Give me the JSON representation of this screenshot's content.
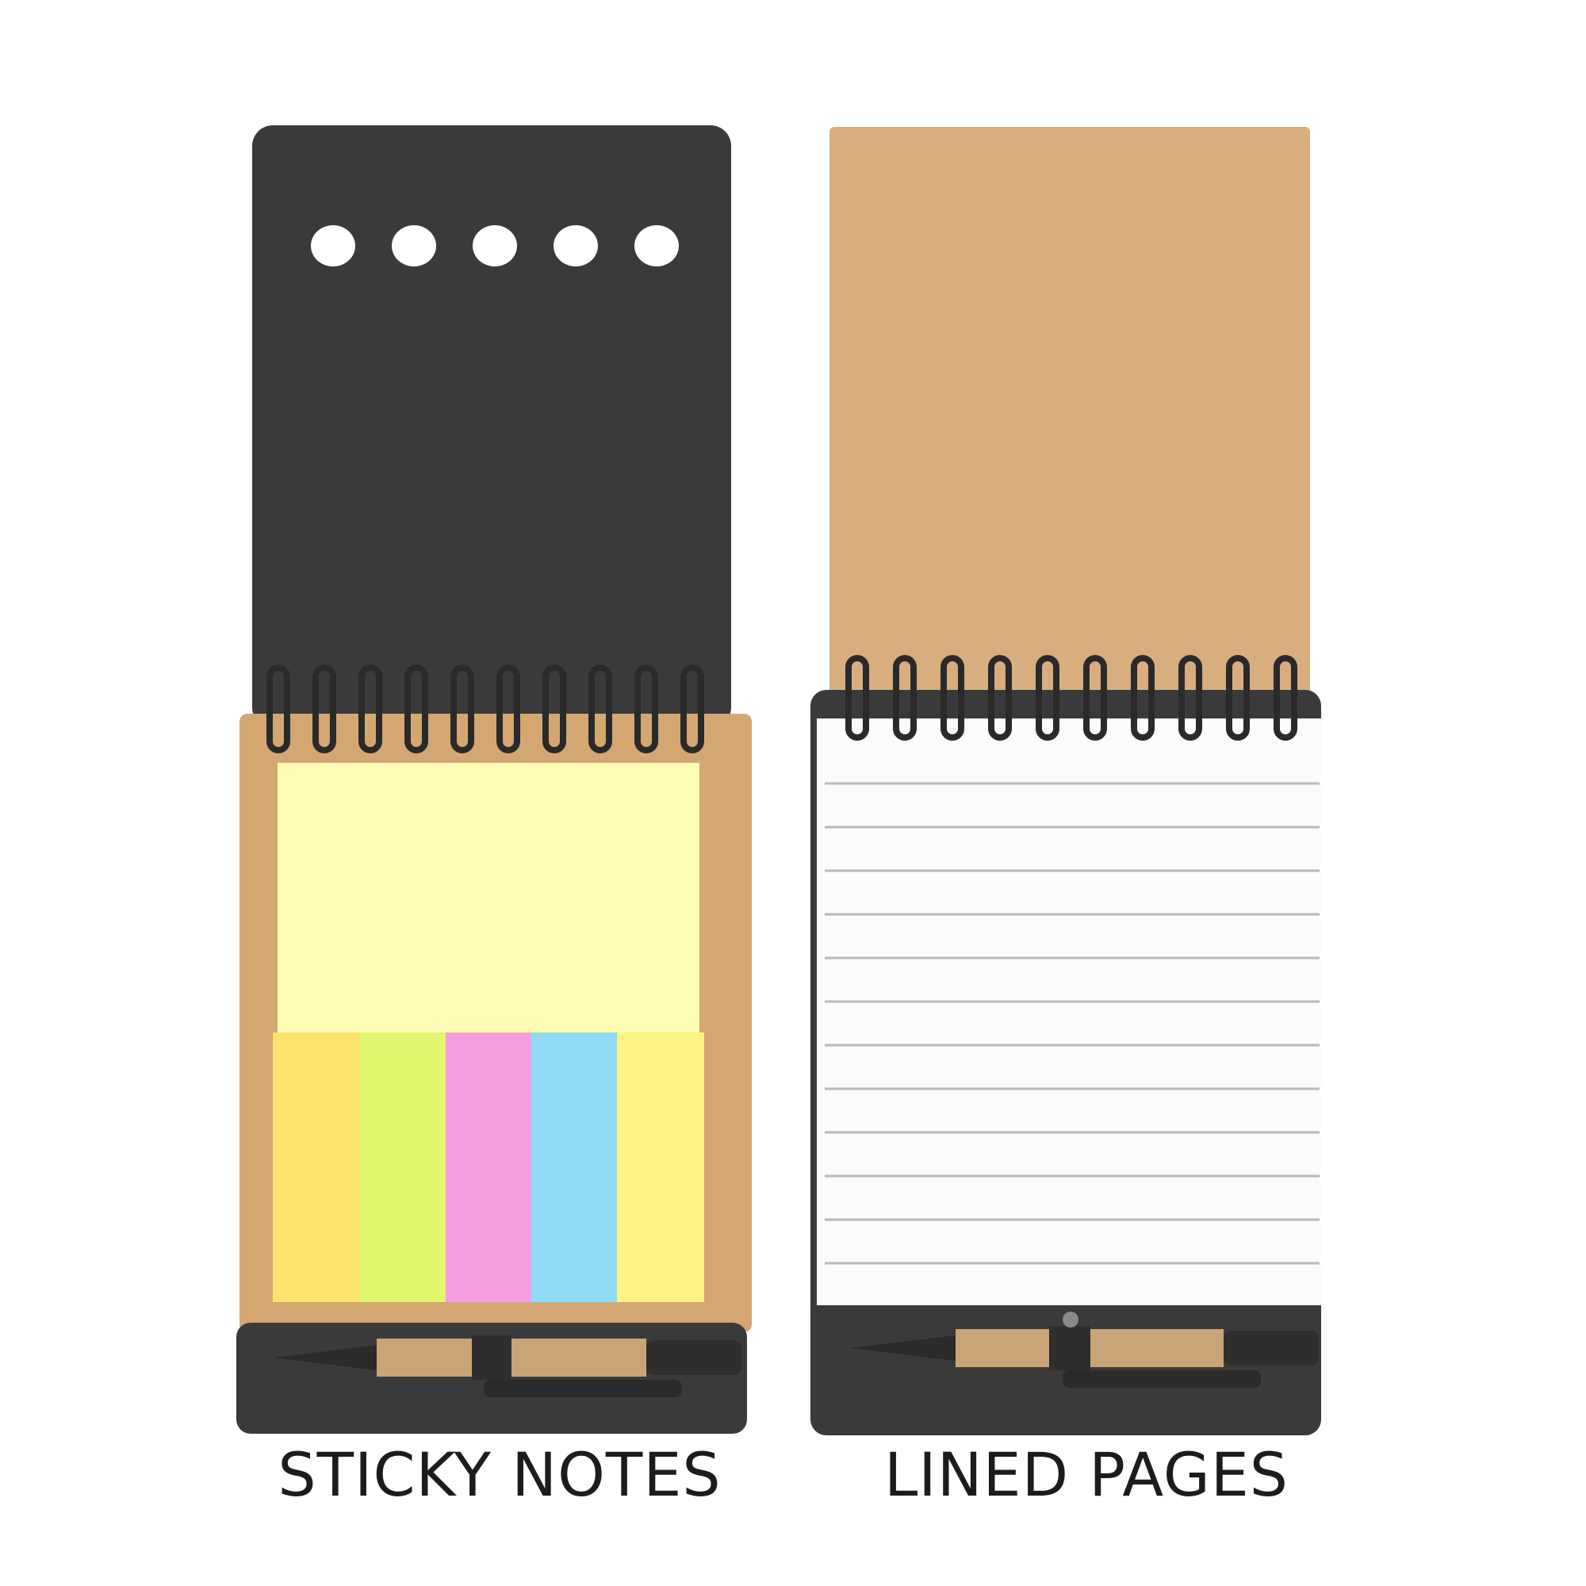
{
  "products": [
    {
      "caption": "STICKY NOTES",
      "cover_color": "#3a3a3a",
      "base_color": "#d4a772",
      "note_colors": {
        "main_pad": "#fdfbb4",
        "flags": [
          "#fde26e",
          "#e2f56e",
          "#f59de0",
          "#8fdcf4",
          "#fcf582"
        ]
      }
    },
    {
      "caption": "LINED PAGES",
      "cover_color": "#d8ae7e",
      "base_color": "#3a3a3a",
      "page_color": "#fbfbfb",
      "line_color": "#b9b9b9"
    }
  ]
}
